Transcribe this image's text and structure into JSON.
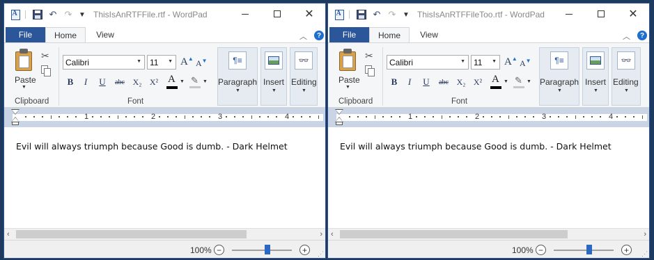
{
  "windows": [
    {
      "id": "left",
      "title": "ThisIsAnRTFFile.rtf - WordPad",
      "document_text": "Evil will always triumph because Good is dumb. - Dark Helmet",
      "zoom_label": "100%",
      "zoom_percent": 100
    },
    {
      "id": "right",
      "title": "ThisIsAnRTFFileToo.rtf - WordPad",
      "document_text": "Evil will always triumph because Good is dumb. - Dark Helmet",
      "zoom_label": "100%",
      "zoom_percent": 100
    }
  ],
  "ribbon": {
    "tabs": {
      "file": "File",
      "home": "Home",
      "view": "View"
    },
    "paste_label": "Paste",
    "clipboard_label": "Clipboard",
    "font_label": "Font",
    "font_name": "Calibri",
    "font_size": "11",
    "paragraph_label": "Paragraph",
    "insert_label": "Insert",
    "editing_label": "Editing",
    "bold": "B",
    "italic": "I",
    "underline": "U",
    "strikethrough": "abc",
    "subscript": "X₂",
    "superscript": "X²",
    "font_color": "A",
    "grow_font": "A",
    "shrink_font": "A"
  },
  "ruler": {
    "numbers": [
      "1",
      "2",
      "3",
      "4"
    ]
  },
  "icons": {
    "app": "wordpad-icon",
    "save": "save-icon",
    "undo": "undo-icon",
    "redo": "redo-icon",
    "minimize": "minimize-icon",
    "maximize": "maximize-icon",
    "close": "close-icon",
    "help": "help-icon"
  },
  "help_symbol": "?",
  "colors": {
    "accent": "#2b579a",
    "zoom_thumb": "#2b68c2",
    "desktop": "#1e3a5f"
  }
}
